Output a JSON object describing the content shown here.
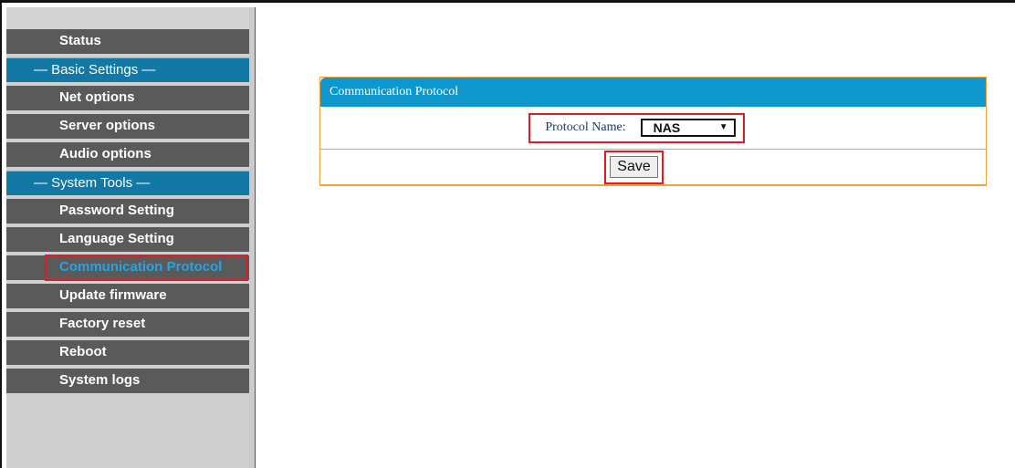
{
  "sidebar": {
    "items": [
      {
        "label": "Status",
        "type": "item",
        "active": false
      },
      {
        "label": "— Basic Settings —",
        "type": "header",
        "active": false
      },
      {
        "label": "Net options",
        "type": "item",
        "active": false
      },
      {
        "label": "Server options",
        "type": "item",
        "active": false
      },
      {
        "label": "Audio options",
        "type": "item",
        "active": false
      },
      {
        "label": "— System Tools —",
        "type": "header",
        "active": false
      },
      {
        "label": "Password Setting",
        "type": "item",
        "active": false
      },
      {
        "label": "Language Setting",
        "type": "item",
        "active": false
      },
      {
        "label": "Communication Protocol",
        "type": "item",
        "active": true
      },
      {
        "label": "Update firmware",
        "type": "item",
        "active": false
      },
      {
        "label": "Factory reset",
        "type": "item",
        "active": false
      },
      {
        "label": "Reboot",
        "type": "item",
        "active": false
      },
      {
        "label": "System logs",
        "type": "item",
        "active": false
      }
    ]
  },
  "panel": {
    "title": "Communication Protocol",
    "protocol_label": "Protocol Name:",
    "protocol_value": "NAS",
    "save_label": "Save"
  },
  "colors": {
    "sidebar_item_bg": "#5a5a5a",
    "sidebar_header_bg": "#1378a3",
    "panel_header_bg": "#0d97cc",
    "panel_border": "#f2a13b",
    "highlight_red": "#e01b24",
    "active_text": "#29a3e0"
  }
}
